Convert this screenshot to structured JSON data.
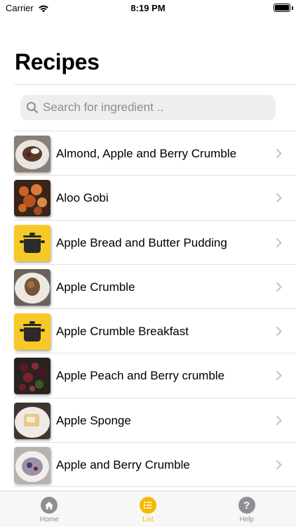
{
  "status_bar": {
    "carrier": "Carrier",
    "time": "8:19 PM"
  },
  "header": {
    "title": "Recipes"
  },
  "search": {
    "placeholder": "Search for ingredient .."
  },
  "recipes": [
    {
      "name": "Almond, Apple and Berry Crumble"
    },
    {
      "name": "Aloo Gobi"
    },
    {
      "name": "Apple Bread and Butter Pudding"
    },
    {
      "name": "Apple Crumble"
    },
    {
      "name": "Apple Crumble Breakfast"
    },
    {
      "name": "Apple Peach and Berry crumble"
    },
    {
      "name": "Apple Sponge"
    },
    {
      "name": "Apple and Berry Crumble"
    }
  ],
  "tabs": [
    {
      "label": "Home",
      "icon": "house-icon"
    },
    {
      "label": "List",
      "icon": "list-icon"
    },
    {
      "label": "Help",
      "icon": "question-icon"
    }
  ],
  "colors": {
    "accent": "#f5b800",
    "placeholder_pot": "#f7c928",
    "inactive": "#8e8e93"
  }
}
